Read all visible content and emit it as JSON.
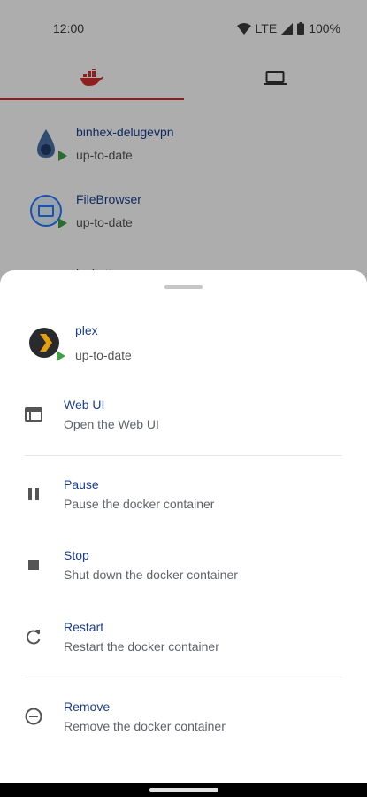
{
  "status_bar": {
    "time": "12:00",
    "network": "LTE",
    "battery": "100%"
  },
  "tabs": [
    {
      "icon": "docker-icon",
      "active": true
    },
    {
      "icon": "laptop-icon",
      "active": false
    }
  ],
  "containers": [
    {
      "name": "binhex-delugevpn",
      "status": "up-to-date",
      "icon": "deluge-icon"
    },
    {
      "name": "FileBrowser",
      "status": "up-to-date",
      "icon": "filebrowser-icon"
    },
    {
      "name": "jackett",
      "status": "",
      "icon": "jackett-icon"
    }
  ],
  "sheet": {
    "container": {
      "name": "plex",
      "status": "up-to-date",
      "icon": "plex-icon"
    },
    "actions": [
      {
        "title": "Web UI",
        "subtitle": "Open the Web UI",
        "icon": "web-window-icon"
      },
      {
        "title": "Pause",
        "subtitle": "Pause the docker container",
        "icon": "pause-icon"
      },
      {
        "title": "Stop",
        "subtitle": "Shut down the docker container",
        "icon": "stop-icon"
      },
      {
        "title": "Restart",
        "subtitle": "Restart the docker container",
        "icon": "restart-icon"
      },
      {
        "title": "Remove",
        "subtitle": "Remove the docker container",
        "icon": "remove-icon"
      }
    ]
  },
  "colors": {
    "accent": "#d32f2f",
    "link": "#1a3d8f",
    "running": "#43a047"
  }
}
